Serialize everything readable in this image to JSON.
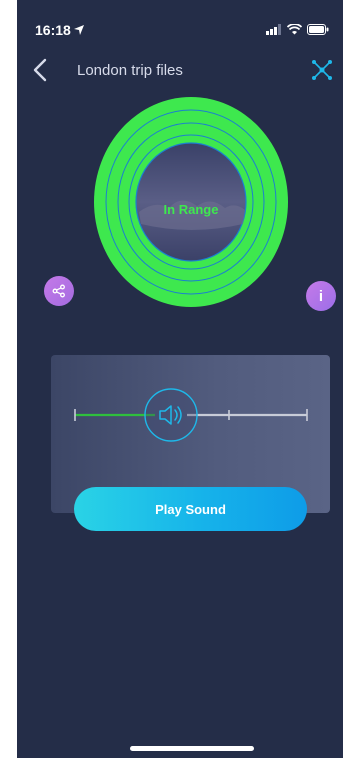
{
  "status_bar": {
    "time": "16:18",
    "icons": [
      "location-arrow-icon",
      "signal-icon",
      "wifi-icon",
      "battery-icon"
    ]
  },
  "header": {
    "title": "London trip files",
    "back_icon": "chevron-left-icon",
    "network_icon": "network-nodes-icon"
  },
  "range_indicator": {
    "status": "In Range",
    "ring_color": "#3ee84e",
    "line_color": "#1b7fd0"
  },
  "actions": {
    "share_icon": "share-icon",
    "info_label": "i"
  },
  "sound_panel": {
    "volume_icon": "speaker-icon",
    "volume_level": 0.25,
    "play_label": "Play Sound"
  },
  "colors": {
    "background": "#242d48",
    "accent": "#1eb8e9",
    "in_range": "#3ee84e",
    "action": "#b874e6"
  }
}
